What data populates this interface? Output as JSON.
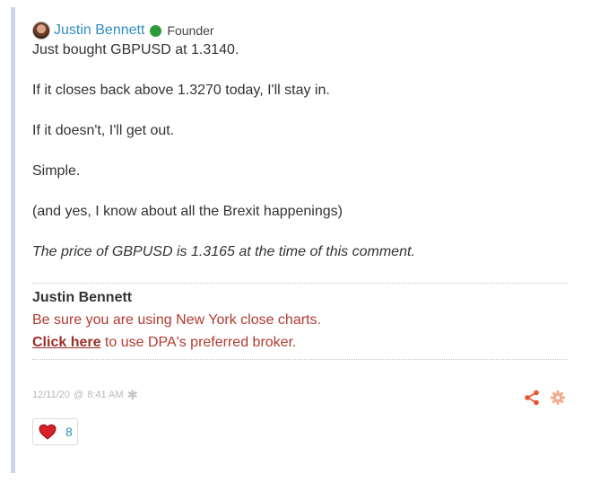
{
  "comment": {
    "author": {
      "name": "Justin Bennett",
      "role": "Founder"
    },
    "paragraphs": [
      "Just bought GBPUSD at 1.3140.",
      "If it closes back above 1.3270 today, I'll stay in.",
      "If it doesn't, I'll get out.",
      "Simple.",
      "(and yes, I know about all the Brexit happenings)"
    ],
    "price_note": "The price of GBPUSD is 1.3165 at the time of this comment.",
    "signature": {
      "name": "Justin Bennett",
      "line1": "Be sure you are using New York close charts.",
      "link_text": "Click here",
      "line2_rest": " to use DPA's preferred broker."
    },
    "meta": {
      "date": "12/11/20",
      "at": "@",
      "time": "8:41 AM"
    },
    "likes": {
      "count": "8"
    }
  },
  "colors": {
    "author_link": "#2f8fc0",
    "online": "#2d9a3a",
    "signature_red": "#b03b32",
    "action_orange": "#e8552d",
    "thread_bar": "#c9d7ec"
  },
  "icons": [
    "avatar",
    "online-status-icon",
    "asterisk-icon",
    "share-icon",
    "gear-icon",
    "heart-icon"
  ]
}
